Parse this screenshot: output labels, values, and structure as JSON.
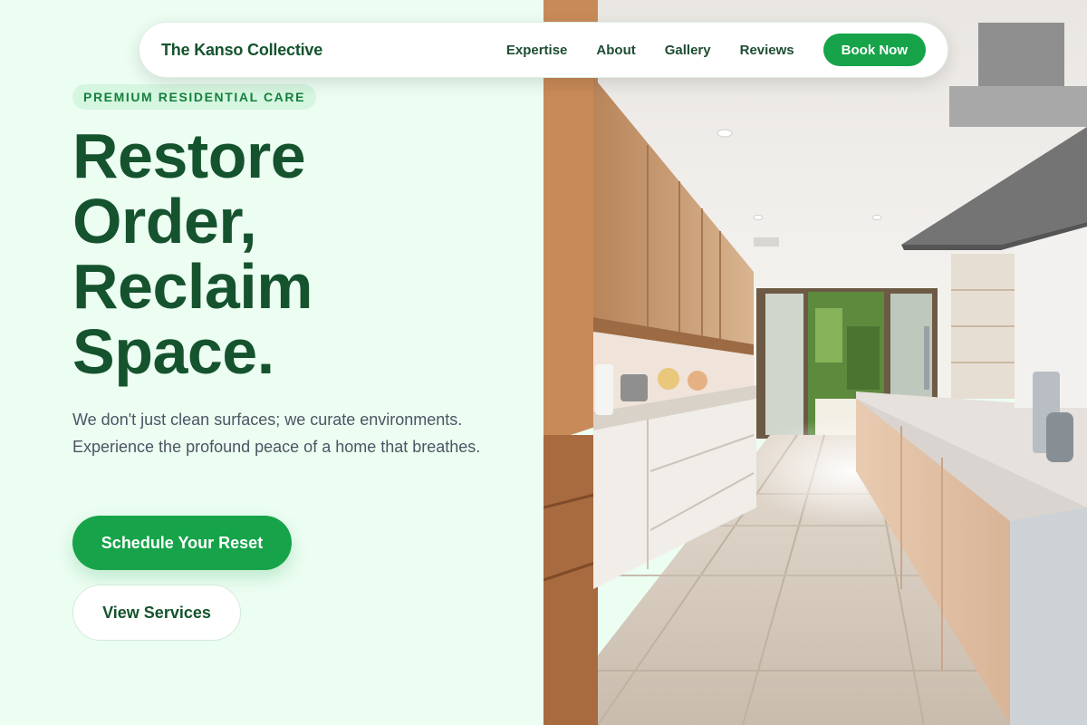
{
  "nav": {
    "brand": "The Kanso Collective",
    "links": [
      "Expertise",
      "About",
      "Gallery",
      "Reviews"
    ],
    "cta": "Book Now"
  },
  "hero": {
    "tagline": "PREMIUM RESIDENTIAL CARE",
    "headline": [
      "Restore",
      "Order,",
      "Reclaim",
      "Space."
    ],
    "subtext": "We don't just clean surfaces; we curate environments. Experience the profound peace of a home that breathes.",
    "primary_cta": "Schedule Your Reset",
    "secondary_cta": "View Services"
  },
  "colors": {
    "brand_green": "#16a34a",
    "dark_green": "#14532d",
    "panel_bg": "#ecfdf2"
  }
}
